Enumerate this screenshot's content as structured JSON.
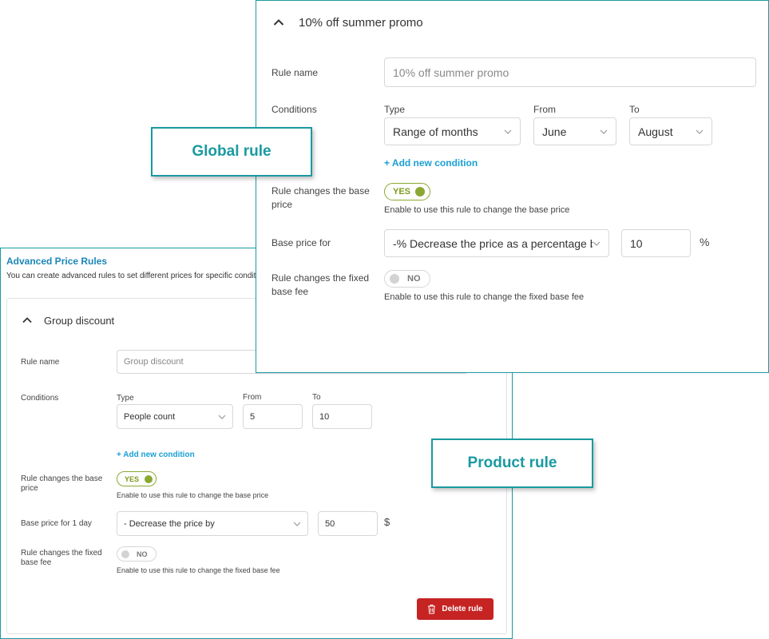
{
  "product": {
    "title": "Advanced Price Rules",
    "description": "You can create advanced rules to set different prices for specific conditi",
    "rule": {
      "name_header": "Group discount",
      "labels": {
        "rule_name": "Rule name",
        "conditions": "Conditions",
        "base_change": "Rule changes the base price",
        "base_price_for": "Base price for 1 day",
        "fixed_change": "Rule changes the fixed base fee"
      },
      "rule_name_placeholder": "Group discount",
      "condition": {
        "type_label": "Type",
        "type_value": "People count",
        "from_label": "From",
        "from_value": "5",
        "to_label": "To",
        "to_value": "10"
      },
      "add_condition": "+ Add new condition",
      "base_toggle": "YES",
      "base_hint": "Enable to use this rule to change the base price",
      "base_price_option": "- Decrease the price by",
      "base_price_value": "50",
      "base_price_unit": "$",
      "fixed_toggle": "NO",
      "fixed_hint": "Enable to use this rule to change the fixed base fee",
      "delete_button": "Delete rule"
    }
  },
  "global": {
    "rule": {
      "name_header": "10% off summer promo",
      "labels": {
        "rule_name": "Rule name",
        "conditions": "Conditions",
        "base_change": "Rule changes the base price",
        "base_price_for": "Base price for",
        "fixed_change": "Rule changes the fixed base fee"
      },
      "rule_name_placeholder": "10% off summer promo",
      "condition": {
        "type_label": "Type",
        "type_value": "Range of months",
        "from_label": "From",
        "from_value": "June",
        "to_label": "To",
        "to_value": "August"
      },
      "add_condition": "+ Add new condition",
      "base_toggle": "YES",
      "base_hint": "Enable to use this rule to change the base price",
      "base_price_option": "-% Decrease the price as a percentage by",
      "base_price_value": "10",
      "base_price_unit": "%",
      "fixed_toggle": "NO",
      "fixed_hint": "Enable to use this rule to change the fixed base fee"
    }
  },
  "callouts": {
    "global": "Global rule",
    "product": "Product rule"
  },
  "icons": {
    "collapse": "chevron-up-icon",
    "select": "chevron-down-icon",
    "delete": "trash-icon"
  },
  "colors": {
    "accent_teal": "#1a9aa0",
    "link_blue": "#1a9fd4",
    "toggle_green": "#8aa832",
    "danger_red": "#c62323"
  }
}
